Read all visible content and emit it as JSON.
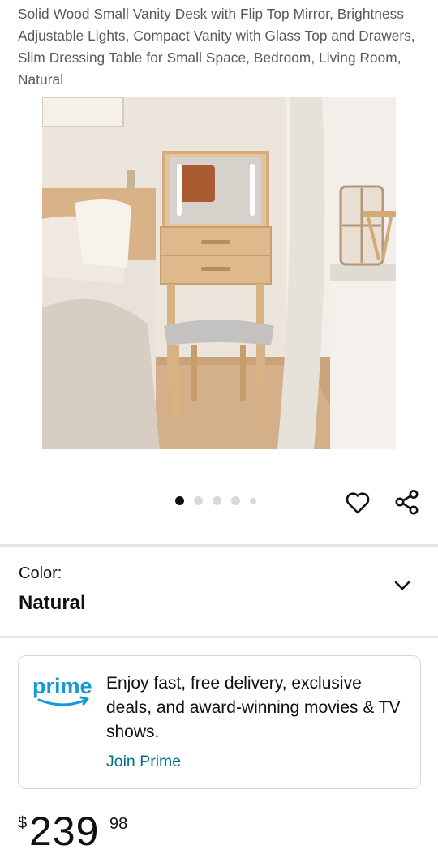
{
  "product": {
    "title": "Solid Wood Small Vanity Desk with Flip Top Mirror, Brightness Adjustable Lights, Compact Vanity with Glass Top and Drawers, Slim Dressing Table for Small Space, Bedroom, Living Room, Natural"
  },
  "gallery": {
    "image_count": 5,
    "current_index": 1
  },
  "actions": {
    "wishlist_icon": "heart-icon",
    "share_icon": "share-icon"
  },
  "variant": {
    "label": "Color:",
    "value": "Natural",
    "icon": "chevron-down-icon"
  },
  "prime": {
    "logo_text": "prime",
    "message": "Enjoy fast, free delivery, exclusive deals, and award-winning movies & TV shows.",
    "link": "Join Prime"
  },
  "price": {
    "currency": "$",
    "whole": "239",
    "fraction": "98"
  },
  "colors": {
    "link": "#007185",
    "prime_blue": "#1399d6",
    "text": "#0f1111",
    "muted": "#565959"
  }
}
